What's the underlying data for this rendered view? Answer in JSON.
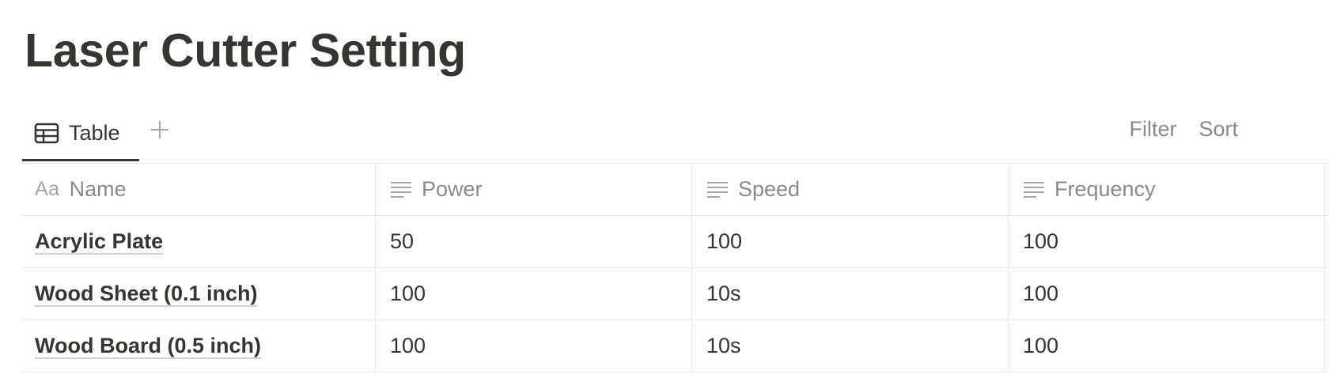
{
  "page": {
    "title": "Laser Cutter Setting"
  },
  "views": {
    "active_tab_label": "Table",
    "active_tab_icon": "table-icon",
    "add_view_icon": "plus-icon",
    "filter_label": "Filter",
    "sort_label": "Sort"
  },
  "table": {
    "columns": [
      {
        "label": "Name",
        "icon": "aa-title-icon",
        "icon_text": "Aa"
      },
      {
        "label": "Power",
        "icon": "text-lines-icon"
      },
      {
        "label": "Speed",
        "icon": "text-lines-icon"
      },
      {
        "label": "Frequency",
        "icon": "text-lines-icon"
      }
    ],
    "rows": [
      {
        "name": "Acrylic Plate",
        "power": "50",
        "speed": "100",
        "frequency": "100"
      },
      {
        "name": "Wood Sheet (0.1 inch)",
        "power": "100",
        "speed": "10s",
        "frequency": "100"
      },
      {
        "name": "Wood Board (0.5 inch)",
        "power": "100",
        "speed": "10s",
        "frequency": "100"
      }
    ]
  },
  "colors": {
    "text": "#37352f",
    "muted": "#8a8a86",
    "border": "#e9e9e7"
  }
}
